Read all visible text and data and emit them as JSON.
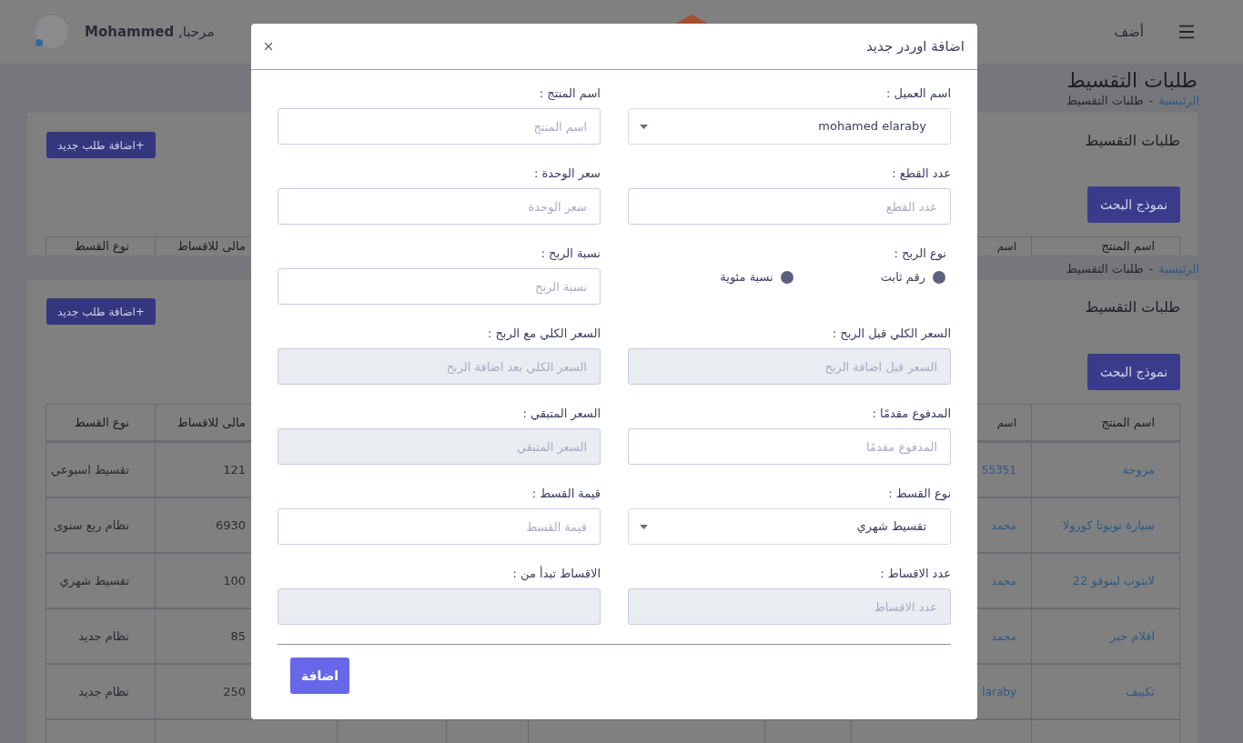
{
  "header": {
    "greeting": "مرحبا, **Mohammed**",
    "add_label": "أضف"
  },
  "sections": [
    {
      "title": "طلبات التقسيط",
      "breadcrumb": {
        "home": "الرئيسية",
        "separator": "-",
        "current": "طلبات التقسيط"
      },
      "card": {
        "title": "طلبات التقسيط",
        "add_button": "+اضافة طلب جديد",
        "search_button": "نموذج البحث",
        "columns": [
          "اسم المنتج",
          "اسم",
          "مالى للاقساط",
          "نوع القسط"
        ]
      }
    },
    {
      "breadcrumb": {
        "home": "الرئيسية",
        "separator": "-",
        "current": "طلبات التقسيط"
      },
      "card": {
        "title": "طلبات التقسيط",
        "add_button": "+اضافة طلب جديد",
        "search_button": "نموذج البحث",
        "columns": [
          "اسم المنتج",
          "اسم",
          "مالى للاقساط",
          "نوع القسط"
        ],
        "rows": [
          {
            "cells": [
              "مروحة",
              "55351",
              "121",
              "تقسيط اسبوعي"
            ]
          },
          {
            "cells": [
              "سيارة تويوتا كورولا",
              "محمد",
              "6930",
              "نظام ربع سنوى"
            ]
          },
          {
            "cells": [
              "لابتوب لينوفو 22",
              "محمد",
              "100",
              "تقسيط شهري"
            ]
          },
          {
            "cells": [
              "اقلام حبر",
              "محمد",
              "85",
              "نظام جديد"
            ]
          },
          {
            "cells": [
              "تكييف",
              "laraby",
              "250",
              "نظام جديد"
            ]
          }
        ]
      }
    }
  ],
  "modal": {
    "title": "اضافة اوردر جديد",
    "fields": [
      {
        "kind": "select",
        "label": "اسم العميل :",
        "value": "mohamed elaraby"
      },
      {
        "kind": "text",
        "label": "اسم المنتج :",
        "placeholder": "اسم المنتج",
        "disabled": false
      },
      {
        "kind": "text",
        "label": "عدد القطع :",
        "placeholder": "عدد القطع",
        "disabled": false
      },
      {
        "kind": "text",
        "label": "سعر الوحدة :",
        "placeholder": "سعر الوحدة",
        "disabled": false
      },
      {
        "kind": "radio",
        "label": "نوع الربح :",
        "options": [
          {
            "label": "رقم ثابت",
            "selected": false
          },
          {
            "label": "نسبة مئوية",
            "selected": false
          }
        ]
      },
      {
        "kind": "text",
        "label": "نسبة الربح :",
        "placeholder": "نسبة الربح",
        "disabled": false
      },
      {
        "kind": "text",
        "label": "السعر الكلي قبل الربح :",
        "placeholder": "السعر قبل اضافة الربح",
        "disabled": true
      },
      {
        "kind": "text",
        "label": "السعر الكلي مع الربح :",
        "placeholder": "السعر الكلي بعد اضافة الربح",
        "disabled": true
      },
      {
        "kind": "text",
        "label": "المدفوع مقدمًا :",
        "placeholder": "المدفوع مقدمًا",
        "disabled": false
      },
      {
        "kind": "text",
        "label": "السعر المتبقي :",
        "placeholder": "السعر المتبقي",
        "disabled": true
      },
      {
        "kind": "select",
        "label": "نوع القسط :",
        "value": "تقسيط شهري"
      },
      {
        "kind": "text",
        "label": "قيمة القسط :",
        "placeholder": "قيمة القسط",
        "disabled": false
      },
      {
        "kind": "text",
        "label": "عدد الاقساط :",
        "placeholder": "عدد الاقساط",
        "disabled": true
      },
      {
        "kind": "text",
        "label": "الاقساط تبدأ من :",
        "disabled": true
      }
    ],
    "submit_button": "اضافة"
  }
}
